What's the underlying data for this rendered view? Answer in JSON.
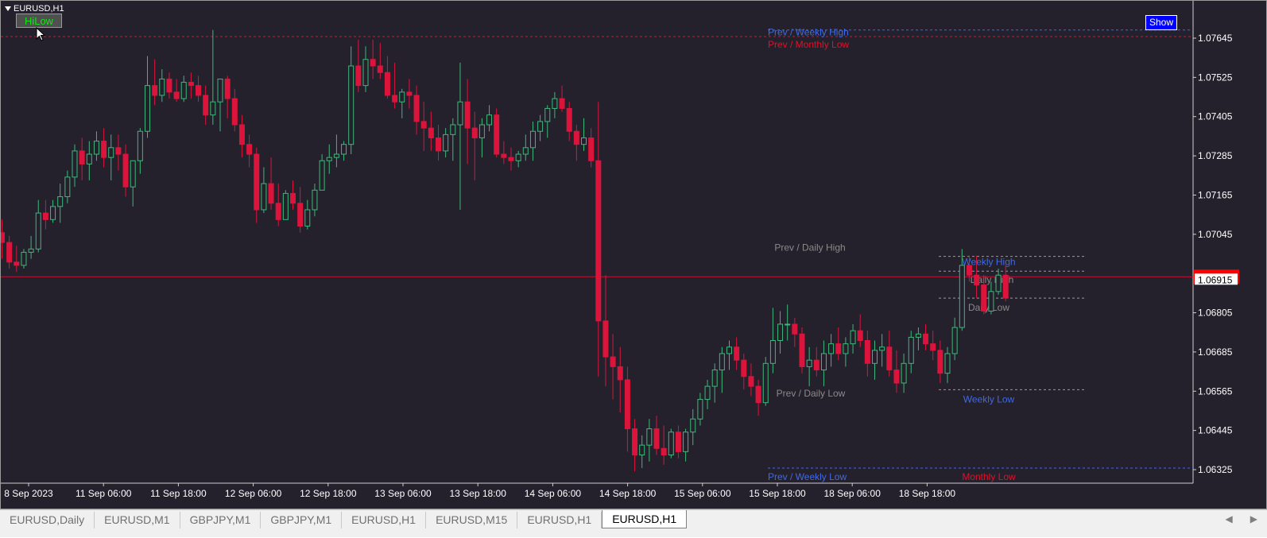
{
  "window": {
    "symbol_title": "EURUSD,H1"
  },
  "toolbar": {
    "hilow_label": "HiLow",
    "show_label": "Show"
  },
  "colors": {
    "background": "#24212c",
    "bull": "#3db87a",
    "bear": "#dc143c",
    "bid_line": "#c8102e",
    "label_blue": "#4169e1",
    "label_gray": "#8a8a8a",
    "label_red": "#e0102a"
  },
  "price_axis": {
    "ticks": [
      "1.07645",
      "1.07525",
      "1.07405",
      "1.07285",
      "1.07165",
      "1.07045",
      "1.06805",
      "1.06685",
      "1.06565",
      "1.06445",
      "1.06325"
    ],
    "current_price": "1.06915"
  },
  "time_axis": {
    "ticks": [
      "8 Sep 2023",
      "11 Sep 06:00",
      "11 Sep 18:00",
      "12 Sep 06:00",
      "12 Sep 18:00",
      "13 Sep 06:00",
      "13 Sep 18:00",
      "14 Sep 06:00",
      "14 Sep 18:00",
      "15 Sep 06:00",
      "15 Sep 18:00",
      "18 Sep 06:00",
      "18 Sep 18:00"
    ]
  },
  "levels": [
    {
      "label": "Prev / Weekly High",
      "price": 1.0767,
      "color": "#4169e1",
      "style": "dotted"
    },
    {
      "label": "Prev / Monthly Low",
      "price": 1.0765,
      "color": "#e0102a",
      "style": "dotted"
    },
    {
      "label": "Prev / Daily High",
      "price": 1.0698,
      "color": "#8a8a8a",
      "style": "none"
    },
    {
      "label": "Weekly High",
      "price": 1.0697,
      "color": "#4169e1",
      "style": "dotted"
    },
    {
      "label": "Daily High",
      "price": 1.0692,
      "color": "#8a8a8a",
      "style": "dotted"
    },
    {
      "label": "Daily Low",
      "price": 1.0684,
      "color": "#8a8a8a",
      "style": "dotted"
    },
    {
      "label": "Prev / Daily Low",
      "price": 1.0657,
      "color": "#8a8a8a",
      "style": "none"
    },
    {
      "label": "Weekly Low",
      "price": 1.0656,
      "color": "#4169e1",
      "style": "dotted"
    },
    {
      "label": "Prev / Weekly Low",
      "price": 1.0632,
      "color": "#4169e1",
      "style": "dotted"
    },
    {
      "label": "Monthly Low",
      "price": 1.0632,
      "color": "#e0102a",
      "style": "none"
    }
  ],
  "chart_data": {
    "type": "candlestick",
    "ylim": [
      1.0629,
      1.0769
    ],
    "candles": [
      [
        1.0705,
        1.0709,
        1.0697,
        1.0702
      ],
      [
        1.0702,
        1.0704,
        1.0694,
        1.0696
      ],
      [
        1.0696,
        1.0701,
        1.0693,
        1.0695
      ],
      [
        1.0695,
        1.07,
        1.0694,
        1.0699
      ],
      [
        1.0699,
        1.0704,
        1.0697,
        1.07
      ],
      [
        1.07,
        1.0715,
        1.0699,
        1.0711
      ],
      [
        1.0711,
        1.0715,
        1.0706,
        1.0709
      ],
      [
        1.0709,
        1.0715,
        1.0708,
        1.0713
      ],
      [
        1.0713,
        1.072,
        1.0708,
        1.0716
      ],
      [
        1.0716,
        1.0724,
        1.0714,
        1.0722
      ],
      [
        1.0722,
        1.0732,
        1.0719,
        1.073
      ],
      [
        1.073,
        1.0734,
        1.0721,
        1.0726
      ],
      [
        1.0726,
        1.0733,
        1.0721,
        1.0729
      ],
      [
        1.0729,
        1.0736,
        1.0727,
        1.0733
      ],
      [
        1.0733,
        1.0737,
        1.0725,
        1.0728
      ],
      [
        1.0728,
        1.0735,
        1.0721,
        1.0731
      ],
      [
        1.0731,
        1.0735,
        1.0724,
        1.0729
      ],
      [
        1.0729,
        1.0732,
        1.0716,
        1.0719
      ],
      [
        1.0719,
        1.0725,
        1.0713,
        1.0727
      ],
      [
        1.0727,
        1.0737,
        1.0723,
        1.0736
      ],
      [
        1.0736,
        1.0759,
        1.0734,
        1.075
      ],
      [
        1.075,
        1.0758,
        1.0744,
        1.0747
      ],
      [
        1.0747,
        1.0755,
        1.0745,
        1.0752
      ],
      [
        1.0752,
        1.0754,
        1.0746,
        1.0748
      ],
      [
        1.0748,
        1.0752,
        1.0745,
        1.0746
      ],
      [
        1.0746,
        1.0753,
        1.0745,
        1.0751
      ],
      [
        1.0751,
        1.0754,
        1.0746,
        1.075
      ],
      [
        1.075,
        1.0753,
        1.0745,
        1.0747
      ],
      [
        1.0747,
        1.075,
        1.0738,
        1.0741
      ],
      [
        1.0741,
        1.0767,
        1.0738,
        1.0745
      ],
      [
        1.0745,
        1.0752,
        1.0736,
        1.0752
      ],
      [
        1.0752,
        1.0753,
        1.074,
        1.0746
      ],
      [
        1.0746,
        1.0749,
        1.0736,
        1.0738
      ],
      [
        1.0738,
        1.0741,
        1.0728,
        1.0732
      ],
      [
        1.0732,
        1.0735,
        1.0725,
        1.0729
      ],
      [
        1.0729,
        1.0731,
        1.0708,
        1.0712
      ],
      [
        1.0712,
        1.0725,
        1.0711,
        1.072
      ],
      [
        1.072,
        1.0728,
        1.0712,
        1.0714
      ],
      [
        1.0714,
        1.072,
        1.0707,
        1.0709
      ],
      [
        1.0709,
        1.0718,
        1.0709,
        1.0717
      ],
      [
        1.0717,
        1.0721,
        1.0712,
        1.0714
      ],
      [
        1.0714,
        1.0719,
        1.0705,
        1.0707
      ],
      [
        1.0707,
        1.0715,
        1.0706,
        1.0712
      ],
      [
        1.0712,
        1.072,
        1.071,
        1.0718
      ],
      [
        1.0718,
        1.0729,
        1.0718,
        1.0727
      ],
      [
        1.0727,
        1.0732,
        1.0723,
        1.0728
      ],
      [
        1.0728,
        1.0735,
        1.0725,
        1.0729
      ],
      [
        1.0729,
        1.0733,
        1.0727,
        1.0732
      ],
      [
        1.0732,
        1.0762,
        1.0729,
        1.0756
      ],
      [
        1.0756,
        1.0764,
        1.0748,
        1.075
      ],
      [
        1.075,
        1.0762,
        1.0748,
        1.0758
      ],
      [
        1.0758,
        1.0764,
        1.0752,
        1.0756
      ],
      [
        1.0756,
        1.0763,
        1.0752,
        1.0754
      ],
      [
        1.0754,
        1.0759,
        1.0746,
        1.0747
      ],
      [
        1.0747,
        1.0757,
        1.0743,
        1.0745
      ],
      [
        1.0745,
        1.0749,
        1.074,
        1.0748
      ],
      [
        1.0748,
        1.0752,
        1.0743,
        1.0747
      ],
      [
        1.0747,
        1.075,
        1.0735,
        1.0739
      ],
      [
        1.0739,
        1.0745,
        1.073,
        1.0737
      ],
      [
        1.0737,
        1.0742,
        1.073,
        1.0734
      ],
      [
        1.0734,
        1.0738,
        1.0727,
        1.073
      ],
      [
        1.073,
        1.0737,
        1.0728,
        1.0735
      ],
      [
        1.0735,
        1.074,
        1.0727,
        1.0738
      ],
      [
        1.0738,
        1.0757,
        1.0712,
        1.0745
      ],
      [
        1.0745,
        1.0752,
        1.0726,
        1.0737
      ],
      [
        1.0737,
        1.0742,
        1.0721,
        1.0734
      ],
      [
        1.0734,
        1.074,
        1.0728,
        1.0738
      ],
      [
        1.0738,
        1.0744,
        1.0736,
        1.0741
      ],
      [
        1.0741,
        1.0743,
        1.0728,
        1.0729
      ],
      [
        1.0729,
        1.0733,
        1.0726,
        1.0728
      ],
      [
        1.0728,
        1.0731,
        1.0724,
        1.0727
      ],
      [
        1.0727,
        1.073,
        1.0725,
        1.0729
      ],
      [
        1.0729,
        1.0735,
        1.0727,
        1.0731
      ],
      [
        1.0731,
        1.0739,
        1.0727,
        1.0736
      ],
      [
        1.0736,
        1.0741,
        1.0733,
        1.0739
      ],
      [
        1.0739,
        1.0744,
        1.0734,
        1.0743
      ],
      [
        1.0743,
        1.0748,
        1.074,
        1.0746
      ],
      [
        1.0746,
        1.075,
        1.0742,
        1.0743
      ],
      [
        1.0743,
        1.0745,
        1.0733,
        1.0736
      ],
      [
        1.0736,
        1.0738,
        1.0727,
        1.0732
      ],
      [
        1.0732,
        1.074,
        1.073,
        1.0734
      ],
      [
        1.0734,
        1.0737,
        1.0725,
        1.0727
      ],
      [
        1.0727,
        1.0745,
        1.0661,
        1.0678
      ],
      [
        1.0678,
        1.0692,
        1.0658,
        1.0667
      ],
      [
        1.0667,
        1.0674,
        1.0654,
        1.0664
      ],
      [
        1.0664,
        1.067,
        1.065,
        1.066
      ],
      [
        1.066,
        1.0664,
        1.0638,
        1.0645
      ],
      [
        1.0645,
        1.0648,
        1.0632,
        1.0637
      ],
      [
        1.0637,
        1.0643,
        1.0633,
        1.064
      ],
      [
        1.064,
        1.0648,
        1.0635,
        1.0645
      ],
      [
        1.0645,
        1.0649,
        1.0637,
        1.0639
      ],
      [
        1.0639,
        1.0646,
        1.0634,
        1.0637
      ],
      [
        1.0637,
        1.0645,
        1.0636,
        1.0644
      ],
      [
        1.0644,
        1.0646,
        1.0636,
        1.0638
      ],
      [
        1.0638,
        1.0645,
        1.0635,
        1.0644
      ],
      [
        1.0644,
        1.0651,
        1.064,
        1.0648
      ],
      [
        1.0648,
        1.0656,
        1.0646,
        1.0654
      ],
      [
        1.0654,
        1.066,
        1.0651,
        1.0658
      ],
      [
        1.0658,
        1.0665,
        1.0653,
        1.0663
      ],
      [
        1.0663,
        1.067,
        1.0656,
        1.0668
      ],
      [
        1.0668,
        1.0672,
        1.0663,
        1.067
      ],
      [
        1.067,
        1.0673,
        1.0663,
        1.0666
      ],
      [
        1.0666,
        1.0668,
        1.0657,
        1.0661
      ],
      [
        1.0661,
        1.0665,
        1.0655,
        1.0658
      ],
      [
        1.0658,
        1.066,
        1.0649,
        1.0653
      ],
      [
        1.0653,
        1.0667,
        1.0652,
        1.0665
      ],
      [
        1.0665,
        1.0682,
        1.0662,
        1.0672
      ],
      [
        1.0672,
        1.0681,
        1.0668,
        1.0677
      ],
      [
        1.0677,
        1.0683,
        1.0672,
        1.0677
      ],
      [
        1.0677,
        1.0679,
        1.067,
        1.0674
      ],
      [
        1.0674,
        1.0676,
        1.0662,
        1.0664
      ],
      [
        1.0664,
        1.067,
        1.0658,
        1.0666
      ],
      [
        1.0666,
        1.067,
        1.0661,
        1.0663
      ],
      [
        1.0663,
        1.0672,
        1.0658,
        1.0668
      ],
      [
        1.0668,
        1.0674,
        1.0664,
        1.0671
      ],
      [
        1.0671,
        1.0676,
        1.0666,
        1.0668
      ],
      [
        1.0668,
        1.0673,
        1.0664,
        1.0671
      ],
      [
        1.0671,
        1.0677,
        1.0668,
        1.0675
      ],
      [
        1.0675,
        1.068,
        1.067,
        1.0672
      ],
      [
        1.0672,
        1.0675,
        1.0661,
        1.0665
      ],
      [
        1.0665,
        1.0672,
        1.066,
        1.0669
      ],
      [
        1.0669,
        1.0674,
        1.0664,
        1.067
      ],
      [
        1.067,
        1.0675,
        1.0661,
        1.0663
      ],
      [
        1.0663,
        1.0669,
        1.0656,
        1.0659
      ],
      [
        1.0659,
        1.0668,
        1.0656,
        1.0665
      ],
      [
        1.0665,
        1.0675,
        1.0662,
        1.0673
      ],
      [
        1.0673,
        1.0676,
        1.0669,
        1.0674
      ],
      [
        1.0674,
        1.0677,
        1.0669,
        1.0671
      ],
      [
        1.0671,
        1.0675,
        1.0666,
        1.0669
      ],
      [
        1.0669,
        1.0672,
        1.0659,
        1.0662
      ],
      [
        1.0662,
        1.067,
        1.0659,
        1.0668
      ],
      [
        1.0668,
        1.0679,
        1.0666,
        1.0676
      ],
      [
        1.0676,
        1.07,
        1.0675,
        1.0695
      ],
      [
        1.0695,
        1.0698,
        1.069,
        1.0692
      ],
      [
        1.0692,
        1.0698,
        1.0685,
        1.0689
      ],
      [
        1.0689,
        1.0692,
        1.068,
        1.0681
      ],
      [
        1.0681,
        1.069,
        1.068,
        1.0687
      ],
      [
        1.0687,
        1.0694,
        1.0686,
        1.0692
      ],
      [
        1.0692,
        1.0695,
        1.0684,
        1.0685
      ]
    ]
  },
  "tabs": [
    {
      "label": "EURUSD,Daily",
      "active": false
    },
    {
      "label": "EURUSD,M1",
      "active": false
    },
    {
      "label": "GBPJPY,M1",
      "active": false
    },
    {
      "label": "GBPJPY,M1",
      "active": false
    },
    {
      "label": "EURUSD,H1",
      "active": false
    },
    {
      "label": "EURUSD,M15",
      "active": false
    },
    {
      "label": "EURUSD,H1",
      "active": false
    },
    {
      "label": "EURUSD,H1",
      "active": true
    }
  ],
  "tab_scroll": {
    "left_icon": "◀",
    "right_icon": "▶"
  }
}
